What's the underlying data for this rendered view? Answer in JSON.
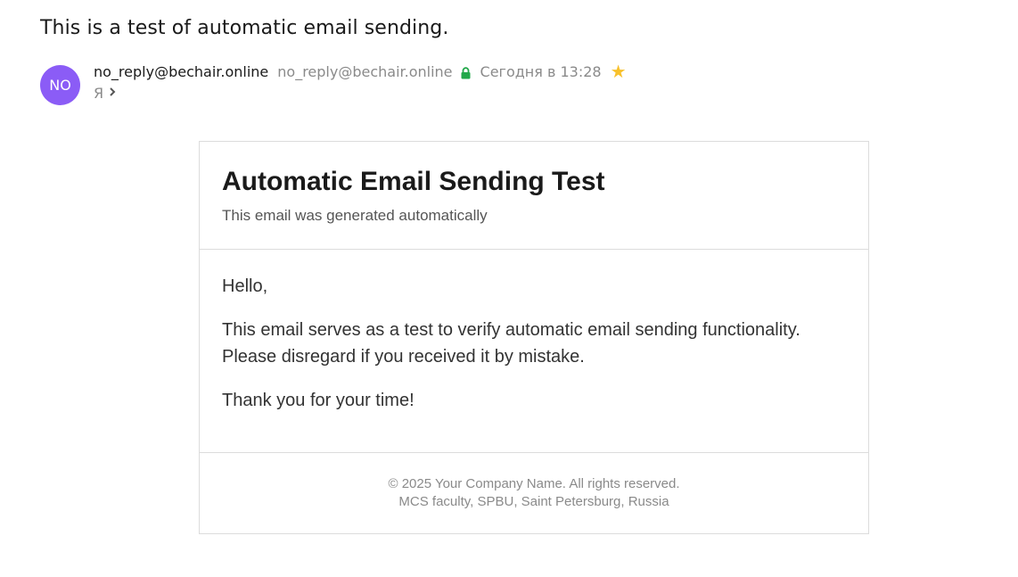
{
  "message": {
    "subject": "This is a test of automatic email sending.",
    "avatar_initials": "NO",
    "sender_name": "no_reply@bechair.online",
    "sender_email": "no_reply@bechair.online",
    "date": "Сегодня в 13:28",
    "recipient": "Я"
  },
  "icons": {
    "lock": "lock-icon",
    "star": "star-icon",
    "chevron": "chevron-right-icon"
  },
  "colors": {
    "avatar_bg": "#8b5cf6",
    "lock": "#22a84a",
    "star": "#f8c12c"
  },
  "email": {
    "title": "Automatic Email Sending Test",
    "subtitle": "This email was generated automatically",
    "greeting": "Hello,",
    "body": "This email serves as a test to verify automatic email sending functionality. Please disregard if you received it by mistake.",
    "thanks": "Thank you for your time!",
    "footer_copyright": "© 2025 Your Company Name. All rights reserved.",
    "footer_address": "MCS faculty, SPBU, Saint Petersburg, Russia"
  }
}
